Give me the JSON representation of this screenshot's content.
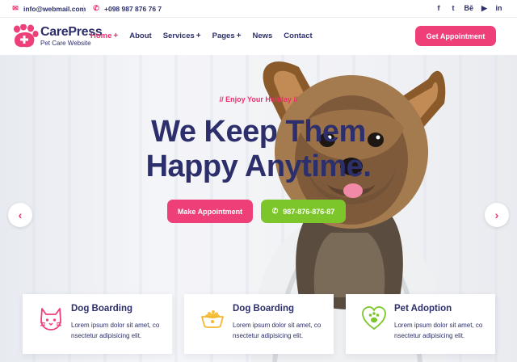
{
  "topbar": {
    "email": "info@webmail.com",
    "phone": "+098 987 876 76 7",
    "social": [
      "f",
      "t",
      "Bē",
      "▶",
      "in"
    ]
  },
  "brand": {
    "name": "CarePress",
    "tagline": "Pet Care Website"
  },
  "menu": {
    "items": [
      {
        "label": "Home",
        "has_plus": true,
        "active": true
      },
      {
        "label": "About"
      },
      {
        "label": "Services",
        "has_plus": true
      },
      {
        "label": "Pages",
        "has_plus": true
      },
      {
        "label": "News"
      },
      {
        "label": "Contact"
      }
    ],
    "plus": "+",
    "cta": "Get Appointment"
  },
  "hero": {
    "eyebrow": "// Enjoy Your Holiday //",
    "headline_line1": "We Keep Them",
    "headline_line2": "Happy Anytime.",
    "make_appointment": "Make Appointment",
    "phone": "987-876-876-87",
    "prev_arrow": "‹",
    "next_arrow": "›"
  },
  "cards": [
    {
      "title": "Dog Boarding",
      "text": "Lorem ipsum dolor sit amet, co nsectetur adipisicing elit.",
      "icon": "cat-face-icon"
    },
    {
      "title": "Dog Boarding",
      "text": "Lorem ipsum dolor sit amet, co nsectetur adipisicing elit.",
      "icon": "pet-bowl-icon"
    },
    {
      "title": "Pet Adoption",
      "text": "Lorem ipsum dolor sit amet, co nsectetur adipisicing elit.",
      "icon": "heart-paw-icon"
    }
  ],
  "colors": {
    "accent_pink": "#ee3f79",
    "accent_green": "#7cc62b",
    "navy": "#2c2f6b"
  }
}
